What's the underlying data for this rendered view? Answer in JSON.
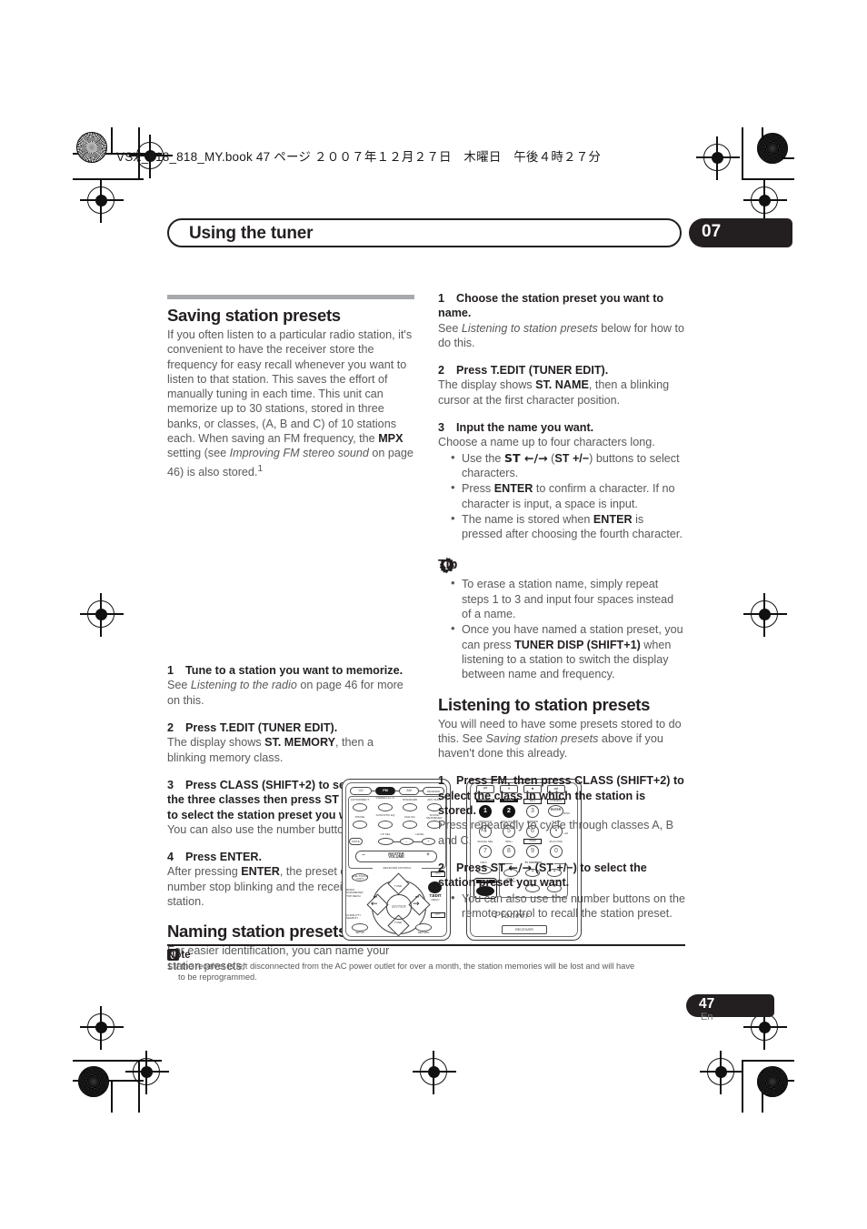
{
  "print_slug": "VSX_918_818_MY.book 47 ページ ２００７年１２月２７日　木曜日　午後４時２７分",
  "running_head": {
    "title": "Using the tuner",
    "chapter": "07"
  },
  "folio": {
    "page": "47",
    "lang": "En"
  },
  "left_column": {
    "section1": {
      "heading": "Saving station presets",
      "intro_1": "If you often listen to a particular radio station, it's convenient to have the receiver store the frequency for easy recall whenever you want to listen to that station. This saves the effort of manually tuning in each time. This unit can memorize up to 30 stations, stored in three banks, or classes, (A, B and C) of 10 stations each. When saving an FM frequency, the ",
      "intro_bold_mpx": "MPX",
      "intro_2": " setting (see ",
      "intro_italic": "Improving FM stereo sound",
      "intro_3": " on page 46) is also stored.",
      "intro_footnote_marker": "1",
      "steps": [
        {
          "n": "1",
          "title": "Tune to a station you want to memorize.",
          "body_pre": "See ",
          "body_italic": "Listening to the radio",
          "body_post": " on page 46 for more on this."
        },
        {
          "n": "2",
          "title": "Press T.EDIT (TUNER EDIT).",
          "body_pre": "The display shows ",
          "body_bold": "ST. MEMORY",
          "body_post": ", then a blinking memory class."
        },
        {
          "n": "3",
          "title_a": "Press CLASS (SHIFT+2) to select one of the three classes then press ST ",
          "title_arrows": "←/→",
          "title_b": " (ST +/−) to select the station preset you want.",
          "body": "You can also use the number buttons."
        },
        {
          "n": "4",
          "title": "Press ENTER.",
          "body_pre": "After pressing ",
          "body_bold": "ENTER",
          "body_post": ", the preset class and number stop blinking and the receiver stores the station."
        }
      ]
    },
    "section2": {
      "heading": "Naming station presets",
      "body": "For easier identification, you can name your station presets."
    }
  },
  "right_column": {
    "naming_steps": [
      {
        "n": "1",
        "title": "Choose the station preset you want to name.",
        "body_pre": "See ",
        "body_italic": "Listening to station presets",
        "body_post": " below for how to do this."
      },
      {
        "n": "2",
        "title": "Press T.EDIT (TUNER EDIT).",
        "body_pre": "The display shows ",
        "body_bold": "ST. NAME",
        "body_post": ", then a blinking cursor at the first character position."
      },
      {
        "n": "3",
        "title": "Input the name you want.",
        "body": "Choose a name up to four characters long."
      }
    ],
    "naming_bullets": [
      {
        "pre": "Use the ",
        "bold_a": "ST ←/→",
        "mid": " (",
        "bold_b": "ST +/−",
        "post": ") buttons to select characters."
      },
      {
        "pre": "Press ",
        "bold_a": "ENTER",
        "post": " to confirm a character. If no character is input, a space is input."
      },
      {
        "pre": "The name is stored when ",
        "bold_a": "ENTER",
        "post": " is pressed after choosing the fourth character."
      }
    ],
    "tip": {
      "icon": "gear-icon",
      "label": "Tip",
      "bullets": [
        {
          "text": "To erase a station name, simply repeat steps 1 to 3 and input four spaces instead of a name."
        },
        {
          "pre": "Once you have named a station preset, you can press ",
          "bold_a": "TUNER DISP (SHIFT+1)",
          "post": " when listening to a station to switch the display between name and frequency."
        }
      ]
    },
    "section3": {
      "heading": "Listening to station presets",
      "body_pre": "You will need to have some presets stored to do this. See ",
      "body_italic": "Saving station presets",
      "body_post": " above if you haven't done this already.",
      "steps": [
        {
          "n": "1",
          "title": "Press FM, then press CLASS (SHIFT+2) to select the class in which the station is stored.",
          "body": "Press repeatedly to cycle through classes A, B and C."
        },
        {
          "n": "2",
          "title_a": "Press ST ",
          "title_arrows": "←/→",
          "title_b": " (ST +/−) to select the station preset you want.",
          "bullets": [
            "You can also use the number buttons on the remote control to recall the station preset."
          ]
        }
      ]
    }
  },
  "note": {
    "icon": "note-icon",
    "label": "Note",
    "marker": "1",
    "text": "If the receiver is left disconnected from the AC power outlet for over a month, the station memories will be lost and will have",
    "text_cont": "to be reprogrammed."
  },
  "illustration": {
    "caption": "remote-control-diagram",
    "left_remote": {
      "source_row": [
        "CD",
        "FM",
        "AM",
        "RECEIVER"
      ],
      "source_highlight": "FM",
      "mode_buttons": [
        "AUTO/DIRECT",
        "STEREO A.L.C.",
        "STANDARD",
        "ADV SURR",
        "PHASE",
        "ACOUSTIC EQ",
        "DIALOG",
        "SOUND RETRIEVER"
      ],
      "mute_label": "MUTE",
      "ch_sel_label": "CH SEL",
      "level_label": "LEVEL",
      "volume_label": "MASTER VOLUME",
      "panel_label": "RECEIVER CONTROL",
      "one_touch_copy": "ONE TOUCH COPY",
      "ch_plus": "CH+",
      "ch_minus": "CH−",
      "tedit": "T.EDIT",
      "menu": "MENU",
      "tune_up": "TUNE",
      "tune_down": "TUNE",
      "st_left": "ST",
      "st_right": "ST",
      "enter": "ENTER",
      "guide": "GUIDE PTY SEARCH",
      "band_top_menu": "BAND/ PARAMETER TOP MENU",
      "setup": "SETUP",
      "return": "RETURN"
    },
    "right_remote": {
      "transport": [
        "⏮",
        "⏸",
        "⏹",
        "⏭"
      ],
      "shift_labels": [
        "TUNER DISP",
        "CLASS",
        "MPX",
        "F.DIRECT"
      ],
      "numbers": [
        "1",
        "2",
        "3",
        "4",
        "5",
        "6",
        "7",
        "8",
        "9",
        "0"
      ],
      "number_highlight": [
        "1",
        "2"
      ],
      "enter": "ENTER",
      "disc": "DISC",
      "row2_labels": [
        "MIDNIGHT",
        "DIALOGUE",
        "DIMMER",
        "SLEEP"
      ],
      "row3_labels": [
        "SIGNAL SEL",
        "SPK+",
        "HDMI",
        "iPod CTRL"
      ],
      "plus10": "+10",
      "info": "INFO",
      "tv_control": "TV CONTROL",
      "input_select": "INPUT SELECT",
      "tv_ch": "TV CH",
      "tv_vol": "TV VOL",
      "shift": "SHIFT",
      "brand": "Pioneer",
      "receiver": "RECEIVER"
    }
  }
}
